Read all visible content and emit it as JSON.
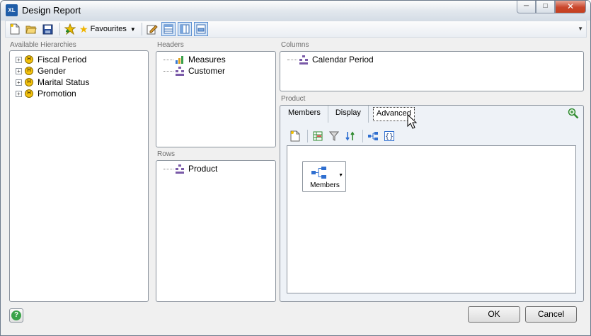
{
  "window": {
    "title": "Design Report",
    "app_icon_text": "XL"
  },
  "toolbar": {
    "favourites_label": "Favourites"
  },
  "available_hierarchies": {
    "caption": "Available Hierarchies",
    "items": [
      {
        "label": "Fiscal Period"
      },
      {
        "label": "Gender"
      },
      {
        "label": "Marital Status"
      },
      {
        "label": "Promotion"
      }
    ]
  },
  "headers": {
    "caption": "Headers",
    "items": [
      {
        "label": "Measures"
      },
      {
        "label": "Customer"
      }
    ]
  },
  "rows": {
    "caption": "Rows",
    "items": [
      {
        "label": "Product"
      }
    ]
  },
  "columns": {
    "caption": "Columns",
    "items": [
      {
        "label": "Calendar Period"
      }
    ]
  },
  "product": {
    "caption": "Product",
    "tabs": [
      {
        "label": "Members"
      },
      {
        "label": "Display"
      },
      {
        "label": "Advanced"
      }
    ],
    "active_tab": "Advanced",
    "members_tile_label": "Members"
  },
  "buttons": {
    "ok": "OK",
    "cancel": "Cancel"
  },
  "colors": {
    "accent": "#1f5da8",
    "close": "#c9462c",
    "hierarchy": "#f4c20d"
  }
}
